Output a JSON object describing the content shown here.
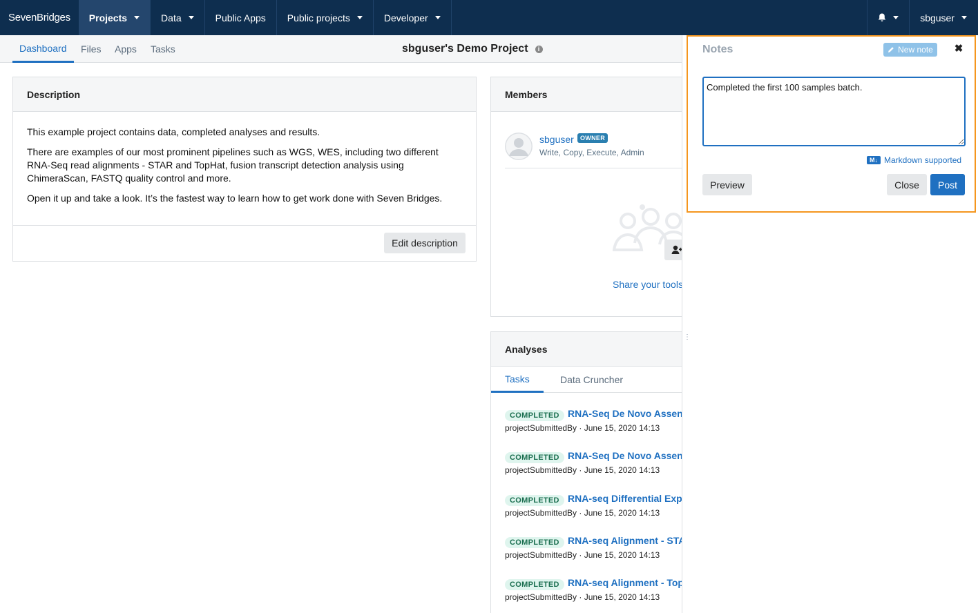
{
  "nav": {
    "brand": "SevenBridges",
    "items": [
      {
        "label": "Projects",
        "dropdown": true
      },
      {
        "label": "Data",
        "dropdown": true
      },
      {
        "label": "Public Apps",
        "dropdown": false
      },
      {
        "label": "Public projects",
        "dropdown": true
      },
      {
        "label": "Developer",
        "dropdown": true
      }
    ],
    "user": "sbguser"
  },
  "subnav": {
    "tabs": [
      "Dashboard",
      "Files",
      "Apps",
      "Tasks"
    ],
    "project_title": "sbguser's Demo Project"
  },
  "description": {
    "heading": "Description",
    "paragraphs": [
      "This example project contains data, completed analyses and results.",
      "There are examples of our most prominent pipelines such as WGS, WES, including two different RNA-Seq read alignments - STAR and TopHat, fusion transcript detection analysis using ChimeraScan, FASTQ quality control and more.",
      "Open it up and take a look. It’s the fastest way to learn how to get work done with Seven Bridges."
    ],
    "edit_label": "Edit description"
  },
  "members": {
    "heading": "Members",
    "name": "sbguser",
    "badge": "OWNER",
    "permissions": "Write, Copy, Execute, Admin",
    "share_text": "Share your tools"
  },
  "analyses": {
    "heading": "Analyses",
    "tabs": [
      "Tasks",
      "Data Cruncher"
    ],
    "tasks": [
      {
        "status": "COMPLETED",
        "name": "RNA-Seq De Novo Assen",
        "submitter": "projectSubmittedBy",
        "date": "June 15, 2020 14:13"
      },
      {
        "status": "COMPLETED",
        "name": "RNA-Seq De Novo Assen",
        "submitter": "projectSubmittedBy",
        "date": "June 15, 2020 14:13"
      },
      {
        "status": "COMPLETED",
        "name": "RNA-seq Differential Exp",
        "submitter": "projectSubmittedBy",
        "date": "June 15, 2020 14:13"
      },
      {
        "status": "COMPLETED",
        "name": "RNA-seq Alignment - STA",
        "submitter": "projectSubmittedBy",
        "date": "June 15, 2020 14:13"
      },
      {
        "status": "COMPLETED",
        "name": "RNA-seq Alignment - Top",
        "submitter": "projectSubmittedBy",
        "date": "June 15, 2020 14:13"
      }
    ]
  },
  "notes": {
    "title": "Notes",
    "new_note": "New note",
    "text": "Completed the first 100 samples batch.",
    "markdown": "Markdown supported",
    "preview_label": "Preview",
    "close_label": "Close",
    "post_label": "Post"
  }
}
